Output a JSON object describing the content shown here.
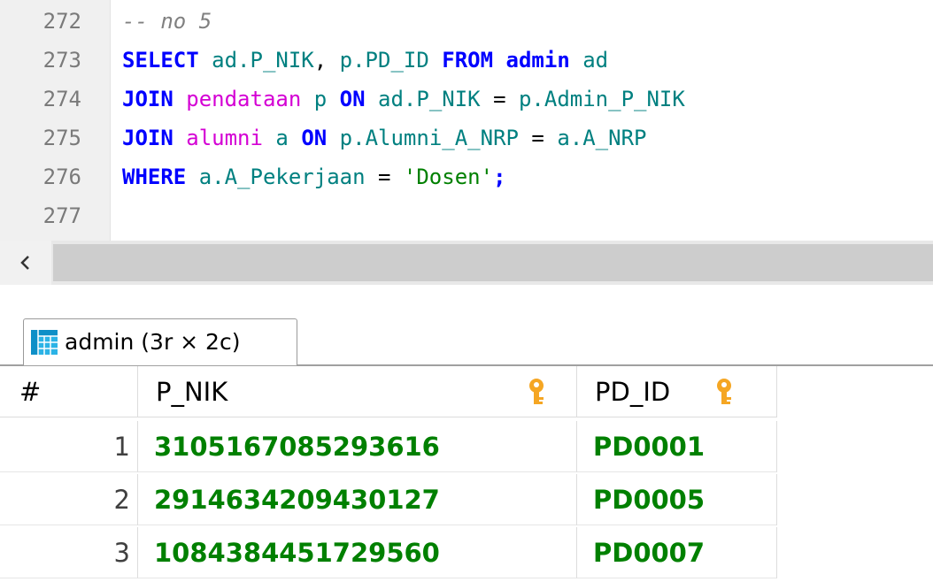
{
  "editor": {
    "lines": [
      {
        "num": "272",
        "comment": "-- no 5"
      },
      {
        "num": "273"
      },
      {
        "num": "274"
      },
      {
        "num": "275"
      },
      {
        "num": "276"
      },
      {
        "num": "277"
      }
    ],
    "q": {
      "select": "SELECT",
      "l273_sel1": "ad.P_NIK",
      "l273_comma": ", ",
      "l273_sel2": "p.PD_ID",
      "from": "FROM",
      "admin": "admin",
      "ad": "ad",
      "join": "JOIN",
      "pendataan": "pendataan",
      "p": "p",
      "on": "ON",
      "l274_left": "ad.P_NIK",
      "eq": "=",
      "l274_right": "p.Admin_P_NIK",
      "alumni": "alumni",
      "a": "a",
      "l275_left": "p.Alumni_A_NRP",
      "l275_right": "a.A_NRP",
      "where": "WHERE",
      "l276_left": "a.A_Pekerjaan",
      "l276_str": "'Dosen'",
      "semi": ";"
    }
  },
  "scrollbar": {
    "left_arrow_icon": "chevron-left-icon"
  },
  "result_tab": {
    "label": "admin (3r × 2c)",
    "icon": "table-grid-icon"
  },
  "grid": {
    "columns": [
      "#",
      "P_NIK",
      "PD_ID"
    ],
    "key_icon": "key-icon",
    "rows": [
      {
        "n": "1",
        "p_nik": "3105167085293616",
        "pd_id": "PD0001"
      },
      {
        "n": "2",
        "p_nik": "2914634209430127",
        "pd_id": "PD0005"
      },
      {
        "n": "3",
        "p_nik": "1084384451729560",
        "pd_id": "PD0007"
      }
    ]
  },
  "colors": {
    "keyword": "#0000ff",
    "table": "#d400d4",
    "column": "#008080",
    "string": "#008000",
    "comment": "#808080",
    "result_value": "#008000",
    "key_icon": "#f5a623"
  }
}
